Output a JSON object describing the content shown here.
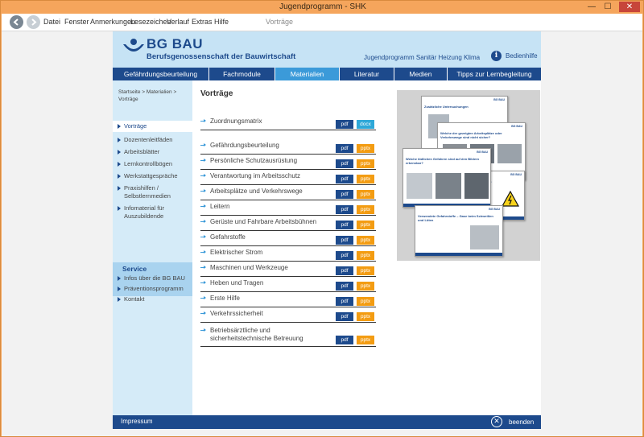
{
  "window": {
    "title": "Jugendprogramm - SHK",
    "min": "—",
    "max": "☐",
    "close": "✕"
  },
  "menu": {
    "items": [
      "Datei",
      "Fenster",
      "Anmerkungen",
      "Lesezeichen",
      "Verlauf",
      "Extras",
      "Hilfe"
    ],
    "location": "Vorträge"
  },
  "header": {
    "logo_text": "BG BAU",
    "logo_sub": "Berufsgenossenschaft der Bauwirtschaft",
    "program": "Jugendprogramm Sanitär Heizung Klima",
    "help_icon": "i",
    "help": "Bedienhilfe"
  },
  "nav": {
    "tabs": [
      "Gefährdungsbeurteilung",
      "Fachmodule",
      "Materialien",
      "Literatur",
      "Medien",
      "Tipps zur Lernbegleitung"
    ],
    "active": "Materialien"
  },
  "sidebar": {
    "breadcrumb": "Startseite  >  Materialien  >  Vorträge",
    "items": [
      "Vorträge",
      "Dozentenleitfäden",
      "Arbeitsblätter",
      "Lernkontrollbögen",
      "Werkstattgespräche",
      "Praxishilfen / Selbstlernmedien",
      "Infomaterial für Auszubildende"
    ],
    "service_title": "Service",
    "service_items": [
      "Infos über die BG BAU",
      "Präventionsprogramm",
      "Kontakt"
    ]
  },
  "main": {
    "title": "Vorträge",
    "docs": [
      {
        "label": "Zuordnungsmatrix",
        "b1": "pdf",
        "b2": "docx"
      },
      {
        "label": "Gefährdungsbeurteilung",
        "b1": "pdf",
        "b2": "pptx"
      },
      {
        "label": "Persönliche Schutzausrüstung",
        "b1": "pdf",
        "b2": "pptx"
      },
      {
        "label": "Verantwortung im Arbeitsschutz",
        "b1": "pdf",
        "b2": "pptx"
      },
      {
        "label": "Arbeitsplätze und Verkehrswege",
        "b1": "pdf",
        "b2": "pptx"
      },
      {
        "label": "Leitern",
        "b1": "pdf",
        "b2": "pptx"
      },
      {
        "label": "Gerüste und Fahrbare Arbeitsbühnen",
        "b1": "pdf",
        "b2": "pptx"
      },
      {
        "label": "Gefahrstoffe",
        "b1": "pdf",
        "b2": "pptx"
      },
      {
        "label": "Elektrischer Strom",
        "b1": "pdf",
        "b2": "pptx"
      },
      {
        "label": "Maschinen und Werkzeuge",
        "b1": "pdf",
        "b2": "pptx"
      },
      {
        "label": "Heben und Tragen",
        "b1": "pdf",
        "b2": "pptx"
      },
      {
        "label": "Erste Hilfe",
        "b1": "pdf",
        "b2": "pptx"
      },
      {
        "label": "Verkehrssicherheit",
        "b1": "pdf",
        "b2": "pptx"
      },
      {
        "label": "Betriebsärztliche und sicherheitstechnische Betreuung",
        "b1": "pdf",
        "b2": "pptx"
      }
    ]
  },
  "preview": {
    "slides": [
      {
        "title": "Zusätzliche Untersuchungen"
      },
      {
        "title": "Welche der gezeigten Arbeitsplätze oder Verkehrswege sind nicht sicher?"
      },
      {
        "title": "Welche tödlichen Gefahren sind auf den Bildern erkennbar?"
      },
      {
        "title": "Vorsicht Strom"
      },
      {
        "title": "Verwendete Gefahrstoffe – Gase beim Schweißen und Löten"
      }
    ],
    "logo": "BG BAU"
  },
  "footer": {
    "impressum": "Impressum",
    "exit_icon": "✕",
    "exit": "beenden"
  },
  "colors": {
    "brand": "#1d4a8c",
    "accent": "#3b9ad9",
    "pptx": "#f39c12",
    "docx": "#2ea8d8",
    "frame": "#f5a55c"
  }
}
